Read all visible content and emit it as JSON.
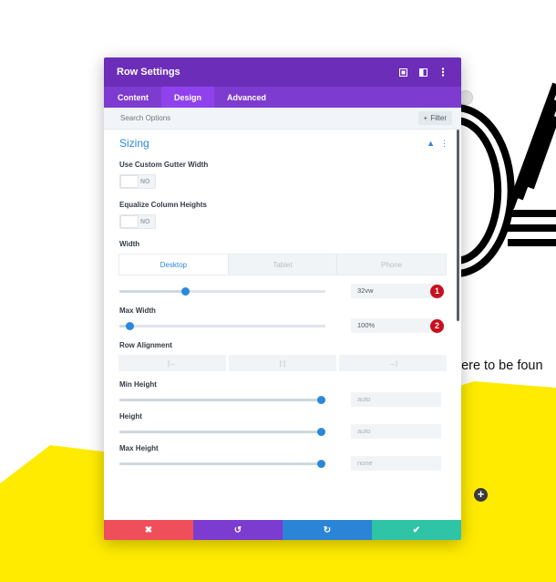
{
  "background": {
    "partial_text": "here to be foun",
    "colors": {
      "yellow": "#ffeb00",
      "ink": "#000000"
    }
  },
  "modal": {
    "title": "Row Settings",
    "header_icons": [
      "expand-icon",
      "sidebar-icon",
      "more-icon"
    ],
    "tabs": [
      {
        "label": "Content",
        "active": false
      },
      {
        "label": "Design",
        "active": true
      },
      {
        "label": "Advanced",
        "active": false
      }
    ],
    "search": {
      "placeholder": "Search Options"
    },
    "filter": {
      "icon": "plus",
      "label": "Filter"
    },
    "section": {
      "title": "Sizing"
    },
    "fields": {
      "gutter": {
        "label": "Use Custom Gutter Width",
        "toggle": "NO"
      },
      "equalize": {
        "label": "Equalize Column Heights",
        "toggle": "NO"
      },
      "width": {
        "label": "Width",
        "devices": [
          "Desktop",
          "Tablet",
          "Phone"
        ],
        "active_device": "Desktop",
        "value": "32vw",
        "slider_level_percent": 32,
        "badge": "1"
      },
      "max_width": {
        "label": "Max Width",
        "value": "100%",
        "slider_level_percent": 5,
        "badge": "2"
      },
      "row_alignment": {
        "label": "Row Alignment",
        "options": [
          "left",
          "center",
          "right"
        ]
      },
      "min_height": {
        "label": "Min Height",
        "value": "auto",
        "slider_level_percent": 98
      },
      "height": {
        "label": "Height",
        "value": "auto",
        "slider_level_percent": 98
      },
      "max_height": {
        "label": "Max Height",
        "value": "none",
        "slider_level_percent": 98
      }
    },
    "footer": [
      "cancel",
      "undo",
      "redo",
      "save"
    ],
    "colors": {
      "header": "#6c2eb9",
      "tabs": "#7e3bd0",
      "accent": "#2b87da",
      "cancel": "#ee4f5b",
      "undo": "#7c3cd0",
      "redo": "#2b84d5",
      "save": "#2ec4a5",
      "badge": "#c8101f"
    }
  }
}
